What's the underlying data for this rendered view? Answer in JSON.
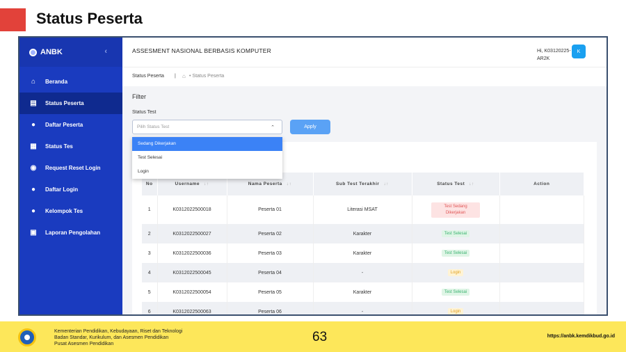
{
  "slide": {
    "title": "Status Peserta",
    "page_number": "63",
    "url": "https://anbk.kemdikbud.go.id",
    "footer_lines": [
      "Kementerian Pendidikan, Kebudayaan, Riset dan Teknologi",
      "Badan Standar, Kurikulum, dan Asesmen Pendidikan",
      "Pusat Asesmen Pendidikan"
    ]
  },
  "app": {
    "brand": "ANBK",
    "collapse": "‹",
    "title": "ASSESMENT NASIONAL BERBASIS KOMPUTER",
    "user_line1": "Hi, K03120225-",
    "user_line2": "AR2K",
    "avatar": "K"
  },
  "sidebar": {
    "items": [
      {
        "label": "Beranda",
        "icon": "⌂"
      },
      {
        "label": "Status Peserta",
        "icon": "▤"
      },
      {
        "label": "Daftar Peserta",
        "icon": "●"
      },
      {
        "label": "Status Tes",
        "icon": "▦"
      },
      {
        "label": "Request Reset Login",
        "icon": "◉"
      },
      {
        "label": "Daftar Login",
        "icon": "●"
      },
      {
        "label": "Kelompok Tes",
        "icon": "●"
      },
      {
        "label": "Laporan Pengolahan",
        "icon": "▣"
      }
    ]
  },
  "breadcrumb": {
    "current": "Status Peserta",
    "sep": "|",
    "home_icon": "⌂",
    "trail": "• Status Peserta"
  },
  "filter": {
    "title": "Filter",
    "status_label": "Status Test",
    "placeholder": "Pilih Status Test",
    "chevron": "⌃",
    "apply": "Apply",
    "options": [
      "Sedang Dikerjakan",
      "Test Selesai",
      "Login"
    ]
  },
  "table": {
    "headers": [
      "No",
      "Username",
      "Nama Peserta",
      "Sub Test Terakhir",
      "Status Test",
      "Action"
    ],
    "sort_icon": "↓↑",
    "rows": [
      {
        "no": "1",
        "username": "K0312022500018",
        "nama": "Peserta 01",
        "sub": "Literasi MSAT",
        "status": "Test Sedang Dikerjakan"
      },
      {
        "no": "2",
        "username": "K0312022500027",
        "nama": "Peserta 02",
        "sub": "Karakter",
        "status": "Test Selesai"
      },
      {
        "no": "3",
        "username": "K0312022500036",
        "nama": "Peserta 03",
        "sub": "Karakter",
        "status": "Test Selesai"
      },
      {
        "no": "4",
        "username": "K0312022500045",
        "nama": "Peserta 04",
        "sub": "-",
        "status": "Login"
      },
      {
        "no": "5",
        "username": "K0312022500054",
        "nama": "Peserta 05",
        "sub": "Karakter",
        "status": "Test Selesai"
      },
      {
        "no": "6",
        "username": "K0312022500063",
        "nama": "Peserta 06",
        "sub": "-",
        "status": "Login"
      }
    ]
  }
}
